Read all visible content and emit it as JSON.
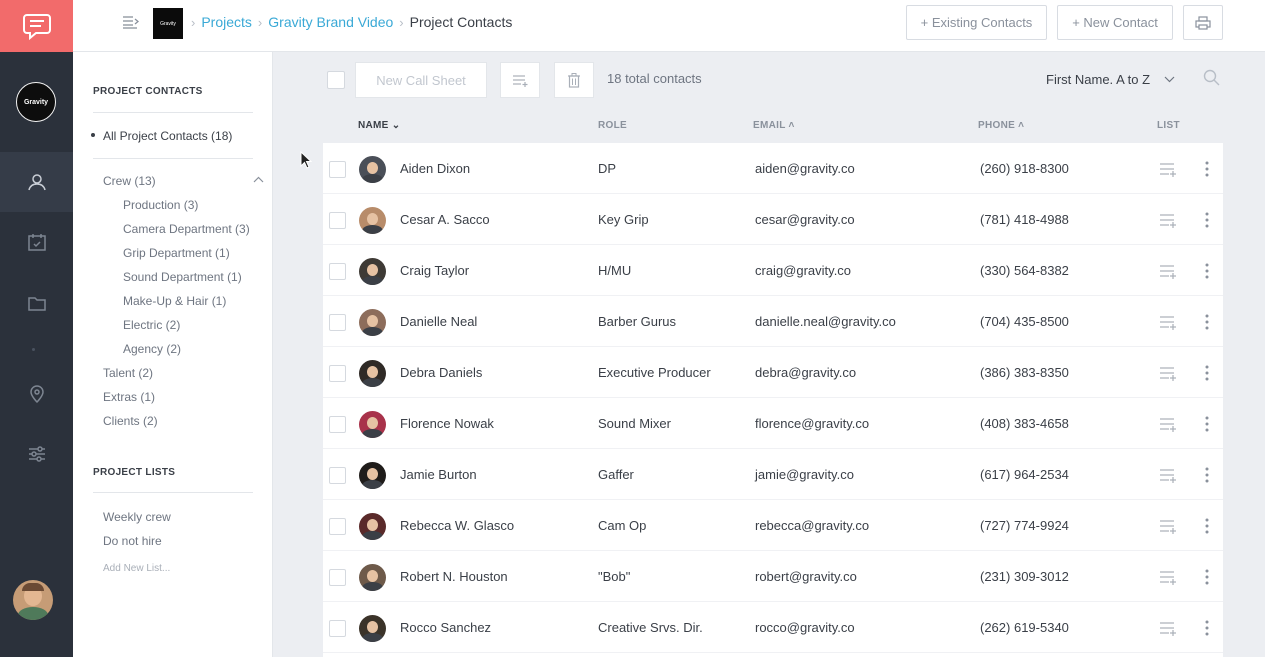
{
  "app": {
    "logo_icon": "chat-bubble-icon",
    "brand_avatar_text": "Gravity",
    "accent": "#f26b6b",
    "link_color": "#3aa9d6"
  },
  "breadcrumb": {
    "items": [
      "Projects",
      "Gravity Brand Video"
    ],
    "current": "Project Contacts",
    "thumb_text": "Gravity"
  },
  "header": {
    "existing_contacts": "+ Existing Contacts",
    "new_contact": "+ New Contact"
  },
  "sidebar": {
    "contacts_heading": "PROJECT CONTACTS",
    "all": "All Project Contacts (18)",
    "crew": "Crew (13)",
    "departments": [
      "Production (3)",
      "Camera Department (3)",
      "Grip Department (1)",
      "Sound Department (1)",
      "Make-Up & Hair (1)",
      "Electric (2)",
      "Agency (2)"
    ],
    "groups": [
      "Talent (2)",
      "Extras (1)",
      "Clients (2)"
    ],
    "lists_heading": "PROJECT LISTS",
    "lists": [
      "Weekly crew",
      "Do not hire"
    ],
    "add_list": "Add New List..."
  },
  "toolbar": {
    "new_call_sheet": "New Call Sheet",
    "total": "18 total contacts",
    "sort": "First Name. A to Z"
  },
  "table": {
    "headers": [
      "NAME",
      "ROLE",
      "EMAIL",
      "PHONE",
      "LIST"
    ],
    "rows": [
      {
        "name": "Aiden Dixon",
        "role": "DP",
        "email": "aiden@gravity.co",
        "phone": "(260) 918-8300"
      },
      {
        "name": "Cesar A. Sacco",
        "role": "Key Grip",
        "email": "cesar@gravity.co",
        "phone": "(781) 418-4988"
      },
      {
        "name": "Craig Taylor",
        "role": "H/MU",
        "email": "craig@gravity.co",
        "phone": "(330) 564-8382"
      },
      {
        "name": "Danielle Neal",
        "role": "Barber Gurus",
        "email": "danielle.neal@gravity.co",
        "phone": "(704) 435-8500"
      },
      {
        "name": "Debra Daniels",
        "role": "Executive Producer",
        "email": "debra@gravity.co",
        "phone": "(386) 383-8350"
      },
      {
        "name": "Florence Nowak",
        "role": "Sound Mixer",
        "email": "florence@gravity.co",
        "phone": "(408) 383-4658"
      },
      {
        "name": "Jamie Burton",
        "role": "Gaffer",
        "email": "jamie@gravity.co",
        "phone": "(617) 964-2534"
      },
      {
        "name": "Rebecca W. Glasco",
        "role": "Cam Op",
        "email": "rebecca@gravity.co",
        "phone": "(727) 774-9924"
      },
      {
        "name": "Robert N. Houston",
        "role": "\"Bob\"",
        "email": "robert@gravity.co",
        "phone": "(231) 309-3012"
      },
      {
        "name": "Rocco Sanchez",
        "role": "Creative Srvs. Dir.",
        "email": "rocco@gravity.co",
        "phone": "(262) 619-5340"
      }
    ]
  }
}
